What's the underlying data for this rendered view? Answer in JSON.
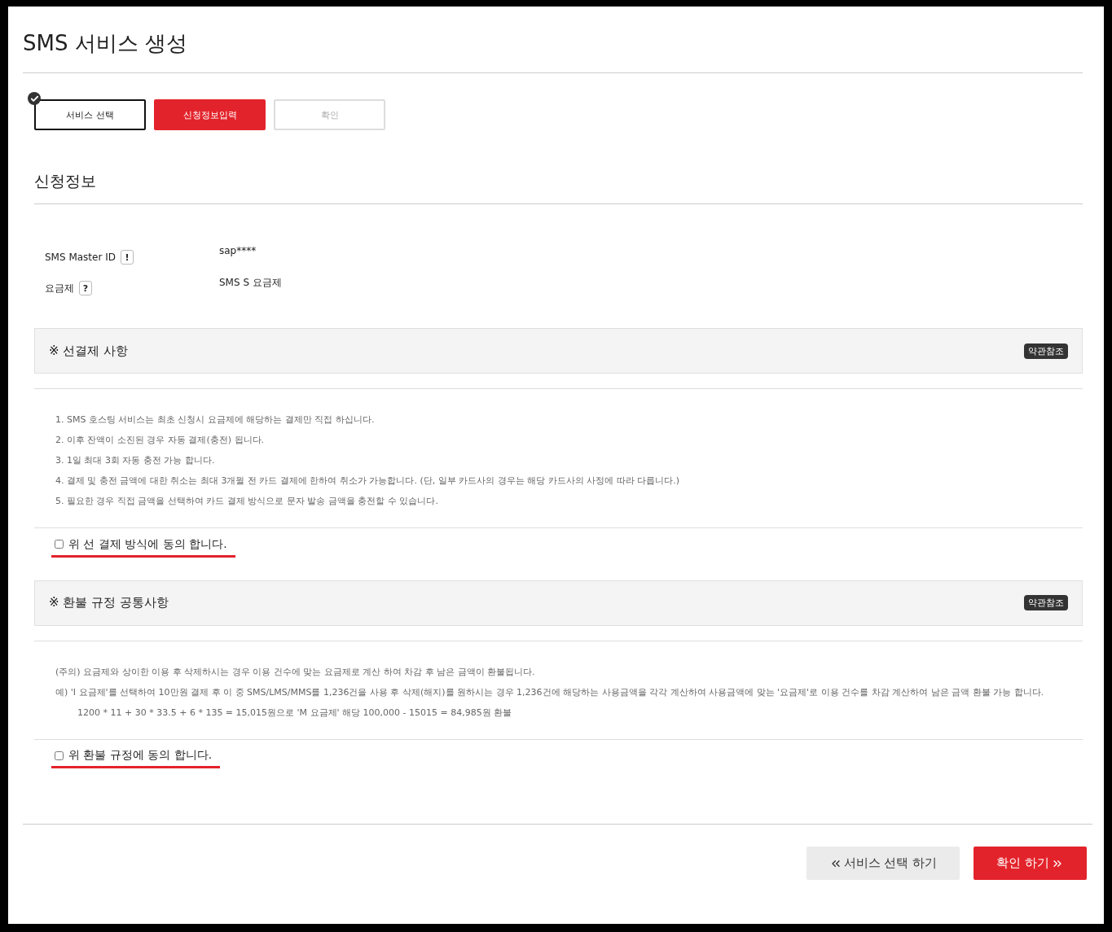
{
  "page_title": "SMS 서비스 생성",
  "steps": [
    {
      "label": "서비스 선택",
      "done": true,
      "selected": false
    },
    {
      "label": "신청정보입력",
      "done": false,
      "selected": true
    },
    {
      "label": "확인",
      "done": false,
      "selected": false
    }
  ],
  "section_title": "신청정보",
  "info_rows": [
    {
      "label": "SMS Master ID",
      "hint": "!",
      "value": "sap****"
    },
    {
      "label": "요금제",
      "hint": "?",
      "value": "SMS S 요금제"
    }
  ],
  "notices": [
    {
      "title": "※ 선결제 사항",
      "badge": "약관참조",
      "lines": [
        {
          "text": "1. SMS 호스팅 서비스는 최초 신청시 요금제에 해당하는 결제만 직접 하십니다.",
          "indent": false
        },
        {
          "text": "2. 이후 잔액이 소진된 경우 자동 결제(충전) 됩니다.",
          "indent": false
        },
        {
          "text": "3. 1일 최대 3회 자동 충전 가능 합니다.",
          "indent": false
        },
        {
          "text": "4. 결제 및 충전 금액에 대한 취소는 최대 3개월 전 카드 결제에 한하여 취소가 가능합니다. (단, 일부 카드사의 경우는 해당 카드사의 사정에 따라 다릅니다.)",
          "indent": false
        },
        {
          "text": "5. 필요한 경우 직접 금액을 선택하여 카드 결제 방식으로 문자 발송 금액을 충전할 수 있습니다.",
          "indent": false
        }
      ],
      "agree": {
        "label": "위 선 결제 방식에 동의 합니다.",
        "checked": false
      }
    },
    {
      "title": "※ 환불 규정 공통사항",
      "badge": "약관참조",
      "lines": [
        {
          "text": "(주의) 요금제와 상이한 이용 후 삭제하시는 경우 이용 건수에 맞는 요금제로 계산 하여 차감 후 남은 금액이 환불됩니다.",
          "indent": false
        },
        {
          "text": "예) 'I 요금제'를 선택하여 10만원 결제 후 이 중 SMS/LMS/MMS를 1,236건을 사용 후 삭제(해지)를 원하시는 경우 1,236건에 해당하는 사용금액을 각각 계산하여 사용금액에 맞는 '요금제'로 이용 건수를 차감 계산하여 남은 금액 환불 가능 합니다.",
          "indent": false
        },
        {
          "text": "1200 * 11 + 30 * 33.5 + 6 * 135 = 15,015원으로 'M 요금제' 해당 100,000 - 15015 = 84,985원 환불",
          "indent": true
        }
      ],
      "agree": {
        "label": "위 환불 규정에 동의 합니다.",
        "checked": false
      }
    }
  ],
  "buttons": [
    {
      "label": "서비스 선택 하기",
      "kind": "back"
    },
    {
      "label": "확인 하기",
      "kind": "next"
    }
  ]
}
